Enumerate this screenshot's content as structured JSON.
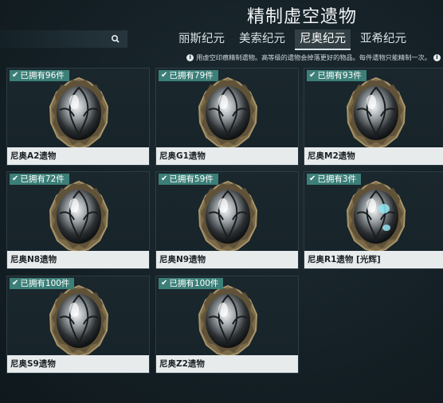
{
  "header": {
    "title": "精制虚空遗物"
  },
  "search": {
    "placeholder": ""
  },
  "tabs": [
    {
      "label": "丽斯纪元",
      "active": false
    },
    {
      "label": "美索纪元",
      "active": false
    },
    {
      "label": "尼奥纪元",
      "active": true
    },
    {
      "label": "亚希纪元",
      "active": false
    }
  ],
  "info": {
    "text": "用虚空印痕精制遗物。高等级的遗物会掉落更好的物品。每件遗物只能精制一次。",
    "icon": "i"
  },
  "relics": [
    {
      "owned": "已拥有96件",
      "name": "尼奥A2遗物",
      "radiant": false
    },
    {
      "owned": "已拥有79件",
      "name": "尼奥G1遗物",
      "radiant": false
    },
    {
      "owned": "已拥有93件",
      "name": "尼奥M2遗物",
      "radiant": false
    },
    {
      "owned": "已拥有72件",
      "name": "尼奥N8遗物",
      "radiant": false
    },
    {
      "owned": "已拥有59件",
      "name": "尼奥N9遗物",
      "radiant": false
    },
    {
      "owned": "已拥有3件",
      "name": "尼奥R1遗物 [光辉]",
      "radiant": true
    },
    {
      "owned": "已拥有100件",
      "name": "尼奥S9遗物",
      "radiant": false
    },
    {
      "owned": "已拥有100件",
      "name": "尼奥Z2遗物",
      "radiant": false
    }
  ],
  "colors": {
    "badge": "#3c7f78",
    "namebar": "#e8ebec",
    "background": "#152127"
  }
}
